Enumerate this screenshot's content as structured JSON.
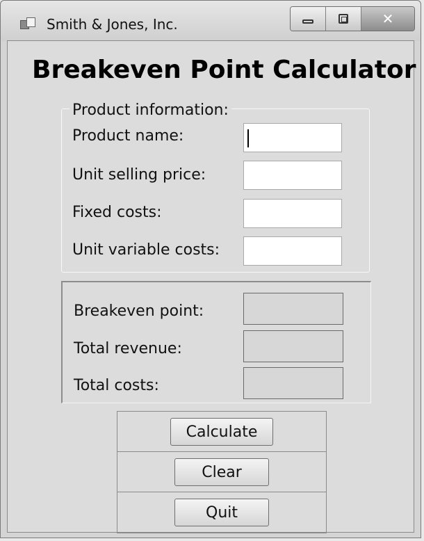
{
  "window": {
    "title": "Smith & Jones, Inc.",
    "controls": {
      "close_glyph": "✕"
    }
  },
  "heading": "Breakeven Point Calculator",
  "product_group": {
    "legend": "Product information:",
    "fields": [
      {
        "label": "Product name:",
        "value": ""
      },
      {
        "label": "Unit selling price:",
        "value": ""
      },
      {
        "label": "Fixed costs:",
        "value": ""
      },
      {
        "label": "Unit variable costs:",
        "value": ""
      }
    ]
  },
  "results_group": {
    "fields": [
      {
        "label": "Breakeven point:",
        "value": ""
      },
      {
        "label": "Total revenue:",
        "value": ""
      },
      {
        "label": "Total costs:",
        "value": ""
      }
    ]
  },
  "buttons": {
    "calculate": "Calculate",
    "clear": "Clear",
    "quit": "Quit"
  }
}
